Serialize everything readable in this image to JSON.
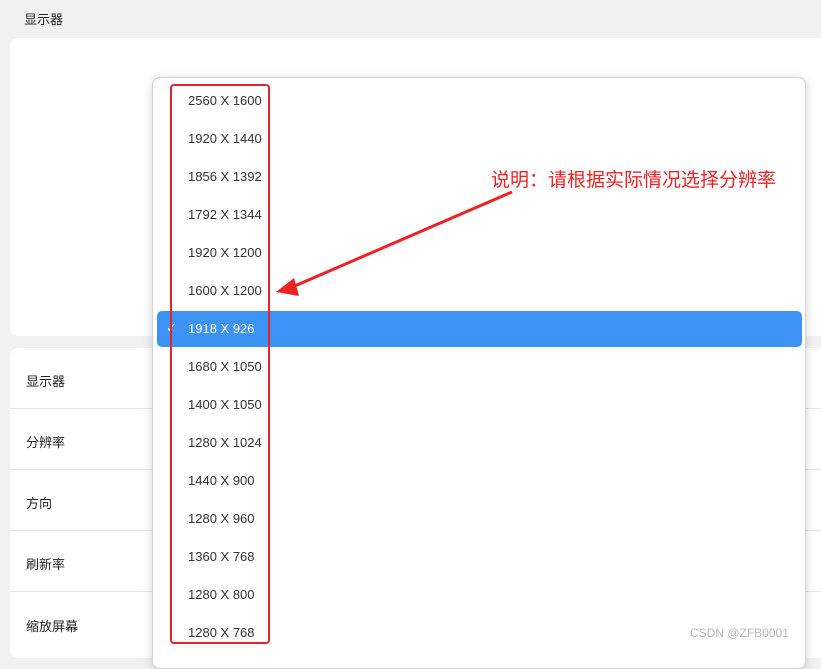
{
  "header": {
    "title": "显示器"
  },
  "settings": {
    "rows": [
      {
        "label": "显示器"
      },
      {
        "label": "分辨率"
      },
      {
        "label": "方向"
      },
      {
        "label": "刷新率"
      },
      {
        "label": "缩放屏幕"
      }
    ]
  },
  "dropdown": {
    "selected_index": 6,
    "check_glyph": "✓",
    "options": [
      "2560 X 1600",
      "1920 X 1440",
      "1856 X 1392",
      "1792 X 1344",
      "1920 X 1200",
      "1600 X 1200",
      "1918 X 926",
      "1680 X 1050",
      "1400 X 1050",
      "1280 X 1024",
      "1440 X 900",
      "1280 X 960",
      "1360 X 768",
      "1280 X 800",
      "1280 X 768"
    ]
  },
  "annotation": {
    "text": "说明：请根据实际情况选择分辨率",
    "color": "#ec2226"
  },
  "watermark": {
    "text": "CSDN @ZFB0001"
  },
  "colors": {
    "selected_bg": "#3d93f5",
    "highlight": "#e8232a"
  }
}
